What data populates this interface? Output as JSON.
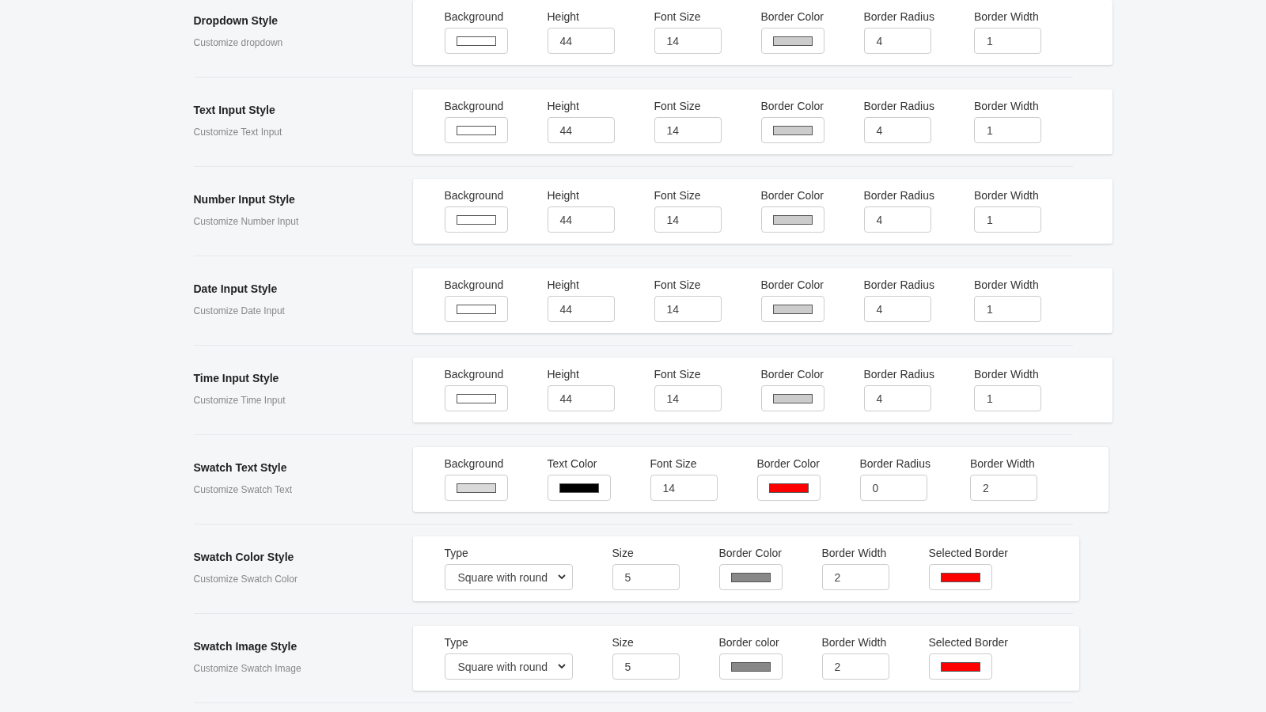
{
  "sections": [
    {
      "title": "Dropdown Style",
      "description": "Customize dropdown",
      "fields": [
        {
          "kind": "color",
          "label": "Background",
          "color": "#ffffff"
        },
        {
          "kind": "number",
          "label": "Height",
          "value": "44"
        },
        {
          "kind": "number",
          "label": "Font Size",
          "value": "14"
        },
        {
          "kind": "color",
          "label": "Border Color",
          "color": "#cccccc"
        },
        {
          "kind": "number",
          "label": "Border Radius",
          "value": "4"
        },
        {
          "kind": "number",
          "label": "Border Width",
          "value": "1"
        }
      ]
    },
    {
      "title": "Text Input Style",
      "description": "Customize Text Input",
      "fields": [
        {
          "kind": "color",
          "label": "Background",
          "color": "#ffffff"
        },
        {
          "kind": "number",
          "label": "Height",
          "value": "44"
        },
        {
          "kind": "number",
          "label": "Font Size",
          "value": "14"
        },
        {
          "kind": "color",
          "label": "Border Color",
          "color": "#cccccc"
        },
        {
          "kind": "number",
          "label": "Border Radius",
          "value": "4"
        },
        {
          "kind": "number",
          "label": "Border Width",
          "value": "1"
        }
      ]
    },
    {
      "title": "Number Input Style",
      "description": "Customize Number Input",
      "fields": [
        {
          "kind": "color",
          "label": "Background",
          "color": "#ffffff"
        },
        {
          "kind": "number",
          "label": "Height",
          "value": "44"
        },
        {
          "kind": "number",
          "label": "Font Size",
          "value": "14"
        },
        {
          "kind": "color",
          "label": "Border Color",
          "color": "#cccccc"
        },
        {
          "kind": "number",
          "label": "Border Radius",
          "value": "4"
        },
        {
          "kind": "number",
          "label": "Border Width",
          "value": "1"
        }
      ]
    },
    {
      "title": "Date Input Style",
      "description": "Customize Date Input",
      "fields": [
        {
          "kind": "color",
          "label": "Background",
          "color": "#ffffff"
        },
        {
          "kind": "number",
          "label": "Height",
          "value": "44"
        },
        {
          "kind": "number",
          "label": "Font Size",
          "value": "14"
        },
        {
          "kind": "color",
          "label": "Border Color",
          "color": "#cccccc"
        },
        {
          "kind": "number",
          "label": "Border Radius",
          "value": "4"
        },
        {
          "kind": "number",
          "label": "Border Width",
          "value": "1"
        }
      ]
    },
    {
      "title": "Time Input Style",
      "description": "Customize Time Input",
      "fields": [
        {
          "kind": "color",
          "label": "Background",
          "color": "#ffffff"
        },
        {
          "kind": "number",
          "label": "Height",
          "value": "44"
        },
        {
          "kind": "number",
          "label": "Font Size",
          "value": "14"
        },
        {
          "kind": "color",
          "label": "Border Color",
          "color": "#cccccc"
        },
        {
          "kind": "number",
          "label": "Border Radius",
          "value": "4"
        },
        {
          "kind": "number",
          "label": "Border Width",
          "value": "1"
        }
      ]
    },
    {
      "title": "Swatch Text Style",
      "description": "Customize Swatch Text",
      "fields": [
        {
          "kind": "color",
          "label": "Background",
          "color": "#d9d9d9"
        },
        {
          "kind": "color",
          "label": "Text Color",
          "color": "#000000"
        },
        {
          "kind": "number",
          "label": "Font Size",
          "value": "14"
        },
        {
          "kind": "color",
          "label": "Border Color",
          "color": "#ff0000"
        },
        {
          "kind": "number",
          "label": "Border Radius",
          "value": "0"
        },
        {
          "kind": "number",
          "label": "Border Width",
          "value": "2"
        }
      ]
    },
    {
      "title": "Swatch Color Style",
      "description": "Customize Swatch Color",
      "fields": [
        {
          "kind": "select",
          "label": "Type",
          "value": "Square with round"
        },
        {
          "kind": "number",
          "label": "Size",
          "value": "5"
        },
        {
          "kind": "color",
          "label": "Border Color",
          "color": "#888888"
        },
        {
          "kind": "number",
          "label": "Border Width",
          "value": "2"
        },
        {
          "kind": "color",
          "label": "Selected Border",
          "color": "#ff0000"
        }
      ]
    },
    {
      "title": "Swatch Image Style",
      "description": "Customize Swatch Image",
      "fields": [
        {
          "kind": "select",
          "label": "Type",
          "value": "Square with round"
        },
        {
          "kind": "number",
          "label": "Size",
          "value": "5"
        },
        {
          "kind": "color",
          "label": "Border color",
          "color": "#888888"
        },
        {
          "kind": "number",
          "label": "Border Width",
          "value": "2"
        },
        {
          "kind": "color",
          "label": "Selected Border",
          "color": "#ff0000"
        }
      ]
    }
  ]
}
